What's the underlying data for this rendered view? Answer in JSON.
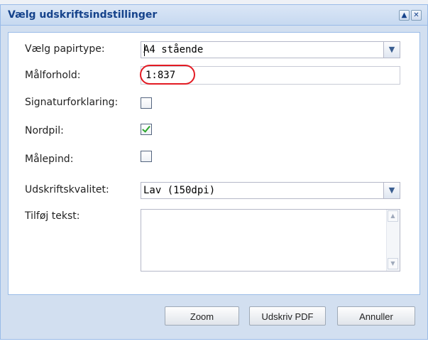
{
  "dialog": {
    "title": "Vælg udskriftsindstillinger",
    "tools": {
      "collapse_icon": "collapse-up-icon",
      "close_icon": "close-icon"
    }
  },
  "form": {
    "paper_type": {
      "label": "Vælg papirtype:",
      "value": "A4 stående"
    },
    "scale": {
      "label": "Målforhold:",
      "value": "1:837",
      "highlight_color": "#e31b23"
    },
    "legend": {
      "label": "Signaturforklaring:",
      "checked": false
    },
    "north_arrow": {
      "label": "Nordpil:",
      "checked": true
    },
    "scale_bar": {
      "label": "Målepind:",
      "checked": false
    },
    "quality": {
      "label": "Udskriftskvalitet:",
      "value": "Lav (150dpi)"
    },
    "text": {
      "label": "Tilføj tekst:",
      "value": ""
    }
  },
  "buttons": {
    "zoom": "Zoom",
    "print_pdf": "Udskriv PDF",
    "cancel": "Annuller"
  },
  "colors": {
    "title_text": "#15428b",
    "panel_background": "#d2dff0",
    "border": "#99bbe8"
  }
}
